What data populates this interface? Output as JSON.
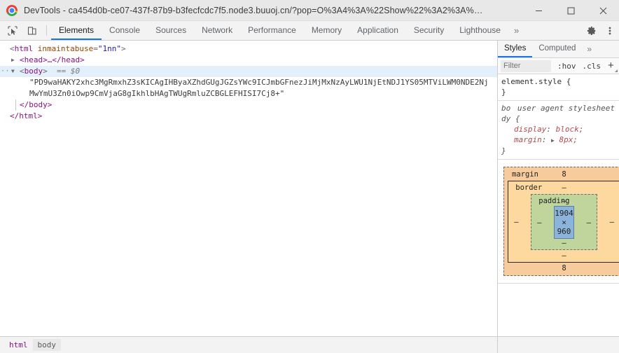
{
  "titlebar": {
    "app_title": "DevTools - ca454d0b-ce07-437f-87b9-b3fecfcdc7f5.node3.buuoj.cn/?pop=O%3A4%3A%22Show%22%3A2%3A%7Bs%3A6...",
    "minimize_label": "–",
    "maximize_label": "□",
    "close_label": "✕"
  },
  "toolbar": {
    "inspect_icon": "inspect-cursor-icon",
    "device_icon": "device-toolbar-icon",
    "tabs": [
      {
        "label": "Elements",
        "active": true
      },
      {
        "label": "Console",
        "active": false
      },
      {
        "label": "Sources",
        "active": false
      },
      {
        "label": "Network",
        "active": false
      },
      {
        "label": "Performance",
        "active": false
      },
      {
        "label": "Memory",
        "active": false
      },
      {
        "label": "Application",
        "active": false
      },
      {
        "label": "Security",
        "active": false
      },
      {
        "label": "Lighthouse",
        "active": false
      }
    ],
    "overflow_label": "»",
    "settings_icon": "gear-icon",
    "menu_icon": "kebab-menu-icon"
  },
  "dom": {
    "line1": {
      "open": "<",
      "tag": "html",
      "attr_name": "inmaintabuse",
      "attr_eq": "=",
      "attr_value": "\"1nn\"",
      "close": ">"
    },
    "line2": {
      "twisty": "▶",
      "text": "<head>…</head>"
    },
    "line3": {
      "dots": "···",
      "twisty": "▼",
      "open": "<",
      "tag": "body",
      "close": ">",
      "marker": "== $0"
    },
    "text_node": "\"PD9waHAKY2xhc3MgRmxhZ3sKICAgIHByaXZhdGUgJGZsYWc9ICJmbGFnezJiMjMxNzAyLWU1NjEtNDJ1YS05MTViLWM0NDE2NjMwYmU3Zn0iOwp9CmVjaG8gIkhlbHAgTWUgRmluZCBGLEFHISI7Cj8+\"",
    "line_close_body": "</body>",
    "line_close_html": "</html>"
  },
  "styles": {
    "tabs": [
      {
        "label": "Styles",
        "active": true
      },
      {
        "label": "Computed",
        "active": false
      }
    ],
    "overflow_label": "»",
    "filter_placeholder": "Filter",
    "filter_value": "",
    "hov_label": ":hov",
    "cls_label": ".cls",
    "new_rule_label": "+",
    "rules": [
      {
        "selector": "element.style {",
        "close": "}",
        "source": "",
        "props": []
      },
      {
        "selector_part1": "bo",
        "selector_part2": "dy {",
        "close": "}",
        "source": "user agent stylesheet",
        "props": [
          {
            "name": "display",
            "value": "block;",
            "expander": ""
          },
          {
            "name": "margin",
            "value": "8px;",
            "expander": "▶"
          }
        ]
      }
    ]
  },
  "box_model": {
    "margin_label": "margin",
    "margin_top": "8",
    "margin_right": "8",
    "margin_bottom": "8",
    "margin_left": "8",
    "border_label": "border",
    "border_top": "–",
    "border_right": "–",
    "border_bottom": "–",
    "border_left": "–",
    "padding_label": "padding",
    "padding_top": "–",
    "padding_right": "–",
    "padding_bottom": "–",
    "padding_left": "–",
    "content_size": "1904 × 960",
    "colors": {
      "margin": "#f8cb9c",
      "border": "#fdd9a0",
      "padding": "#bfd59b",
      "content": "#8cb3d9"
    }
  },
  "breadcrumb": {
    "items": [
      {
        "label": "html",
        "active": false
      },
      {
        "label": "body",
        "active": true
      }
    ]
  }
}
